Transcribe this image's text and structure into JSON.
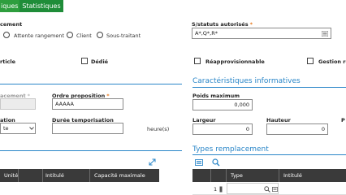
{
  "tabs": [
    {
      "label": "iques",
      "active": true
    },
    {
      "label": "Statistiques",
      "active": false
    }
  ],
  "colors": {
    "tab_active": "#2e9e3e",
    "tab_inactive": "#1f8d39",
    "accent": "#2a86c8",
    "required": "#e87a1f",
    "grid_header": "#3a3a3a"
  },
  "form": {
    "rangement_label": "cement",
    "radio_options": [
      "Attente rangement",
      "Client",
      "Sous-traitant"
    ],
    "statuts_label": "S/statuts autorisés",
    "statuts_value": "A*,Q*,R*",
    "article_label": "rticle",
    "dedie_label": "Dédié",
    "reappro_label": "Réapprovisionnable",
    "gestion_label": "Gestion re",
    "emplacement_label": "acement",
    "ordre_label": "Ordre proposition",
    "ordre_value": "AAAAA",
    "ation_label": "ation",
    "ation_value": "te",
    "duree_label": "Durée temporisation",
    "duree_value": "",
    "duree_unit": "heure(s)"
  },
  "carac": {
    "title": "Caractéristiques informatives",
    "poids_label": "Poids maximum",
    "poids_value": "0,000",
    "largeur_label": "Largeur",
    "largeur_value": "0",
    "hauteur_label": "Hauteur",
    "hauteur_value": "0",
    "p_label": "P"
  },
  "left_table": {
    "columns": [
      "Unité",
      "Intitulé",
      "Capacité maximale"
    ]
  },
  "types": {
    "title": "Types remplacement",
    "columns": [
      "Type",
      "Intitulé"
    ],
    "rows": [
      {
        "num": "1"
      }
    ]
  },
  "icons": [
    "expand-icon",
    "list-icon",
    "search-icon",
    "dropdown-icon"
  ]
}
